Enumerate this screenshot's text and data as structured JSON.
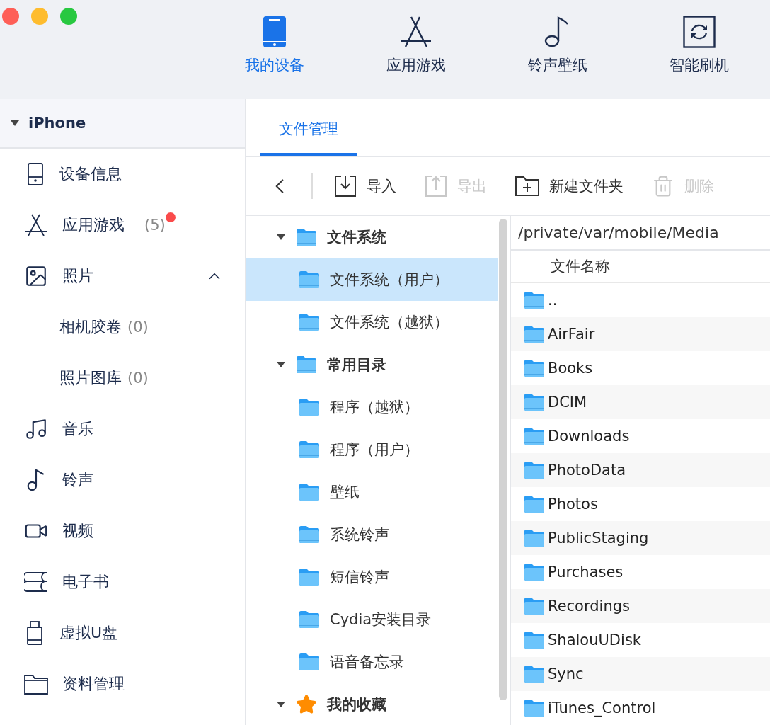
{
  "nav": [
    {
      "label": "我的设备",
      "kind": "device",
      "selected": true
    },
    {
      "label": "应用游戏",
      "kind": "apps",
      "selected": false
    },
    {
      "label": "铃声壁纸",
      "kind": "ringtone",
      "selected": false
    },
    {
      "label": "智能刷机",
      "kind": "flash",
      "selected": false
    }
  ],
  "sidebar": {
    "device": "iPhone",
    "expanded": true,
    "items": [
      {
        "label": "设备信息",
        "kind": "device",
        "selected": false
      },
      {
        "label": "应用游戏",
        "kind": "apps",
        "count": "(5)",
        "notification": true,
        "selected": false
      },
      {
        "label": "照片",
        "kind": "photos",
        "expanded": true,
        "selected": false,
        "children": [
          {
            "label": "相机胶卷",
            "count": "(0)",
            "selected": false
          },
          {
            "label": "照片图库",
            "count": "(0)",
            "selected": false
          }
        ]
      },
      {
        "label": "音乐",
        "kind": "music",
        "selected": false
      },
      {
        "label": "铃声",
        "kind": "ringtone",
        "selected": false
      },
      {
        "label": "视频",
        "kind": "video",
        "selected": false
      },
      {
        "label": "电子书",
        "kind": "ebook",
        "selected": false
      },
      {
        "label": "虚拟U盘",
        "kind": "udisk",
        "selected": false
      },
      {
        "label": "资料管理",
        "kind": "files",
        "selected": false
      }
    ]
  },
  "tabs": [
    {
      "label": "文件管理",
      "selected": true
    }
  ],
  "toolbar": [
    {
      "kind": "back",
      "disabled": false
    },
    {
      "kind": "import",
      "label": "导入",
      "disabled": false
    },
    {
      "kind": "export",
      "label": "导出",
      "disabled": true
    },
    {
      "kind": "new_folder",
      "label": "新建文件夹",
      "disabled": false
    },
    {
      "kind": "delete",
      "label": "删除",
      "disabled": true
    }
  ],
  "tree": [
    {
      "label": "文件系统",
      "kind": "folder",
      "expanded": true,
      "children": [
        {
          "label": "文件系统（用户）",
          "selected": true
        },
        {
          "label": "文件系统（越狱）",
          "selected": false
        }
      ]
    },
    {
      "label": "常用目录",
      "kind": "folder",
      "expanded": true,
      "children": [
        {
          "label": "程序（越狱）",
          "selected": false
        },
        {
          "label": "程序（用户）",
          "selected": false
        },
        {
          "label": "壁纸",
          "selected": false
        },
        {
          "label": "系统铃声",
          "selected": false
        },
        {
          "label": "短信铃声",
          "selected": false
        },
        {
          "label": "Cydia安装目录",
          "selected": false
        },
        {
          "label": "语音备忘录",
          "selected": false
        }
      ]
    },
    {
      "label": "我的收藏",
      "kind": "star",
      "expanded": true
    }
  ],
  "path": "/private/var/mobile/Media",
  "file_list": {
    "columns": [
      "文件名称"
    ],
    "rows": [
      "..",
      "AirFair",
      "Books",
      "DCIM",
      "Downloads",
      "PhotoData",
      "Photos",
      "PublicStaging",
      "Purchases",
      "Recordings",
      "ShalouUDisk",
      "Sync",
      "iTunes_Control"
    ]
  }
}
